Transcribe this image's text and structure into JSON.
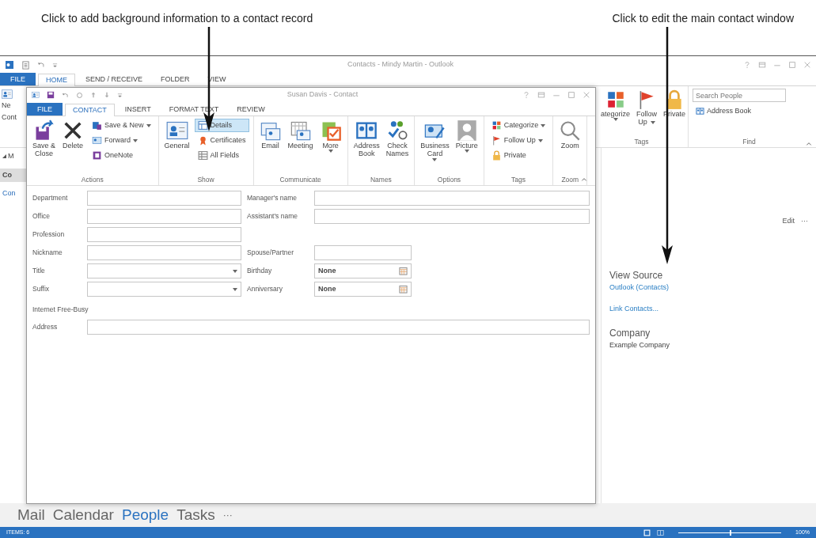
{
  "callouts": [
    {
      "text": "Click to add background information to a contact record"
    },
    {
      "text": "Click to edit the main contact window"
    }
  ],
  "main_window": {
    "title": "Contacts - Mindy Martin - Outlook",
    "tabs": [
      {
        "label": "FILE",
        "kind": "file",
        "selected": false
      },
      {
        "label": "HOME",
        "kind": "tab",
        "selected": true
      },
      {
        "label": "SEND / RECEIVE",
        "kind": "tab",
        "selected": false
      },
      {
        "label": "FOLDER",
        "kind": "tab",
        "selected": false
      },
      {
        "label": "VIEW",
        "kind": "tab",
        "selected": false
      }
    ],
    "ribbon_fragment": [
      "Ne",
      "Cont"
    ],
    "left_pane": [
      {
        "text": "M",
        "kind": "group"
      },
      {
        "text": "Co",
        "kind": "selected"
      },
      {
        "text": "Con",
        "kind": "link"
      }
    ],
    "tags_group": {
      "label": "Tags",
      "buttons": [
        {
          "lines": [
            "ategorize"
          ],
          "caret": true
        },
        {
          "lines": [
            "Follow",
            "Up"
          ],
          "caret": true
        },
        {
          "lines": [
            "Private"
          ],
          "caret": false
        }
      ]
    },
    "find_group": {
      "label": "Find",
      "search": {
        "placeholder": "Search People"
      },
      "address_book": "Address Book"
    },
    "reading_pane": {
      "edit": "Edit",
      "more": "···",
      "sections": [
        {
          "heading": "View Source",
          "lines": [
            {
              "text": "Outlook (Contacts)",
              "kind": "link"
            }
          ]
        },
        {
          "lines": [
            {
              "text": "Link Contacts...",
              "kind": "link"
            }
          ]
        },
        {
          "heading": "Company",
          "lines": [
            {
              "text": "Example Company",
              "kind": "plain"
            }
          ]
        }
      ]
    },
    "navigation": [
      {
        "label": "Mail",
        "selected": false
      },
      {
        "label": "Calendar",
        "selected": false
      },
      {
        "label": "People",
        "selected": true
      },
      {
        "label": "Tasks",
        "selected": false
      }
    ],
    "nav_more": "···",
    "status_bar": {
      "items": "ITEMS: 6",
      "zoom": "100%",
      "zoom_slider": {
        "level": 0.5
      }
    }
  },
  "contact_window": {
    "title": "Susan Davis - Contact",
    "tabs": [
      {
        "label": "FILE",
        "kind": "file",
        "selected": false
      },
      {
        "label": "CONTACT",
        "kind": "tab",
        "selected": true
      },
      {
        "label": "INSERT",
        "kind": "tab",
        "selected": false
      },
      {
        "label": "FORMAT TEXT",
        "kind": "tab",
        "selected": false
      },
      {
        "label": "REVIEW",
        "kind": "tab",
        "selected": false
      }
    ],
    "ribbon_groups": [
      {
        "label": "Actions",
        "items": [
          {
            "kind": "large",
            "lines": [
              "Save &",
              "Close"
            ],
            "caret": false
          },
          {
            "kind": "large",
            "lines": [
              "Delete"
            ],
            "caret": false
          },
          {
            "kind": "stack",
            "buttons": [
              {
                "label": "Save & New",
                "caret": true,
                "selected": false
              },
              {
                "label": "Forward",
                "caret": true,
                "selected": false
              },
              {
                "label": "OneNote",
                "caret": false,
                "selected": false
              }
            ]
          }
        ]
      },
      {
        "label": "Show",
        "items": [
          {
            "kind": "large",
            "lines": [
              "General"
            ],
            "caret": false
          },
          {
            "kind": "stack",
            "buttons": [
              {
                "label": "Details",
                "caret": false,
                "selected": true
              },
              {
                "label": "Certificates",
                "caret": false,
                "selected": false
              },
              {
                "label": "All Fields",
                "caret": false,
                "selected": false
              }
            ]
          }
        ]
      },
      {
        "label": "Communicate",
        "items": [
          {
            "kind": "large",
            "lines": [
              "Email"
            ],
            "caret": false
          },
          {
            "kind": "large",
            "lines": [
              "Meeting"
            ],
            "caret": false
          },
          {
            "kind": "large",
            "lines": [
              "More"
            ],
            "caret": true
          }
        ]
      },
      {
        "label": "Names",
        "items": [
          {
            "kind": "large",
            "lines": [
              "Address",
              "Book"
            ],
            "caret": false
          },
          {
            "kind": "large",
            "lines": [
              "Check",
              "Names"
            ],
            "caret": false
          }
        ]
      },
      {
        "label": "Options",
        "items": [
          {
            "kind": "large",
            "lines": [
              "Business",
              "Card"
            ],
            "caret": true
          },
          {
            "kind": "large",
            "lines": [
              "Picture"
            ],
            "caret": true
          }
        ]
      },
      {
        "label": "Tags",
        "items": [
          {
            "kind": "stack",
            "buttons": [
              {
                "label": "Categorize",
                "caret": true,
                "selected": false
              },
              {
                "label": "Follow Up",
                "caret": true,
                "selected": false
              },
              {
                "label": "Private",
                "caret": false,
                "selected": false
              }
            ]
          }
        ]
      },
      {
        "label": "Zoom",
        "items": [
          {
            "kind": "large",
            "lines": [
              "Zoom"
            ],
            "caret": false
          }
        ]
      }
    ],
    "form": {
      "rows": [
        {
          "left": {
            "label": "Department",
            "kind": "text"
          },
          "right": {
            "label": "Manager's name",
            "kind": "text"
          }
        },
        {
          "left": {
            "label": "Office",
            "kind": "text"
          },
          "right": {
            "label": "Assistant's name",
            "kind": "text"
          }
        },
        {
          "left": {
            "label": "Profession",
            "kind": "text"
          }
        },
        {
          "left": {
            "label": "Nickname",
            "kind": "text"
          },
          "right": {
            "label": "Spouse/Partner",
            "kind": "short"
          }
        },
        {
          "left": {
            "label": "Title",
            "kind": "dropdown"
          },
          "right": {
            "label": "Birthday",
            "kind": "date",
            "value": "None"
          }
        },
        {
          "left": {
            "label": "Suffix",
            "kind": "dropdown"
          },
          "right": {
            "label": "Anniversary",
            "kind": "date",
            "value": "None"
          }
        }
      ],
      "section": "Internet Free-Busy",
      "address": {
        "label": "Address"
      }
    }
  }
}
